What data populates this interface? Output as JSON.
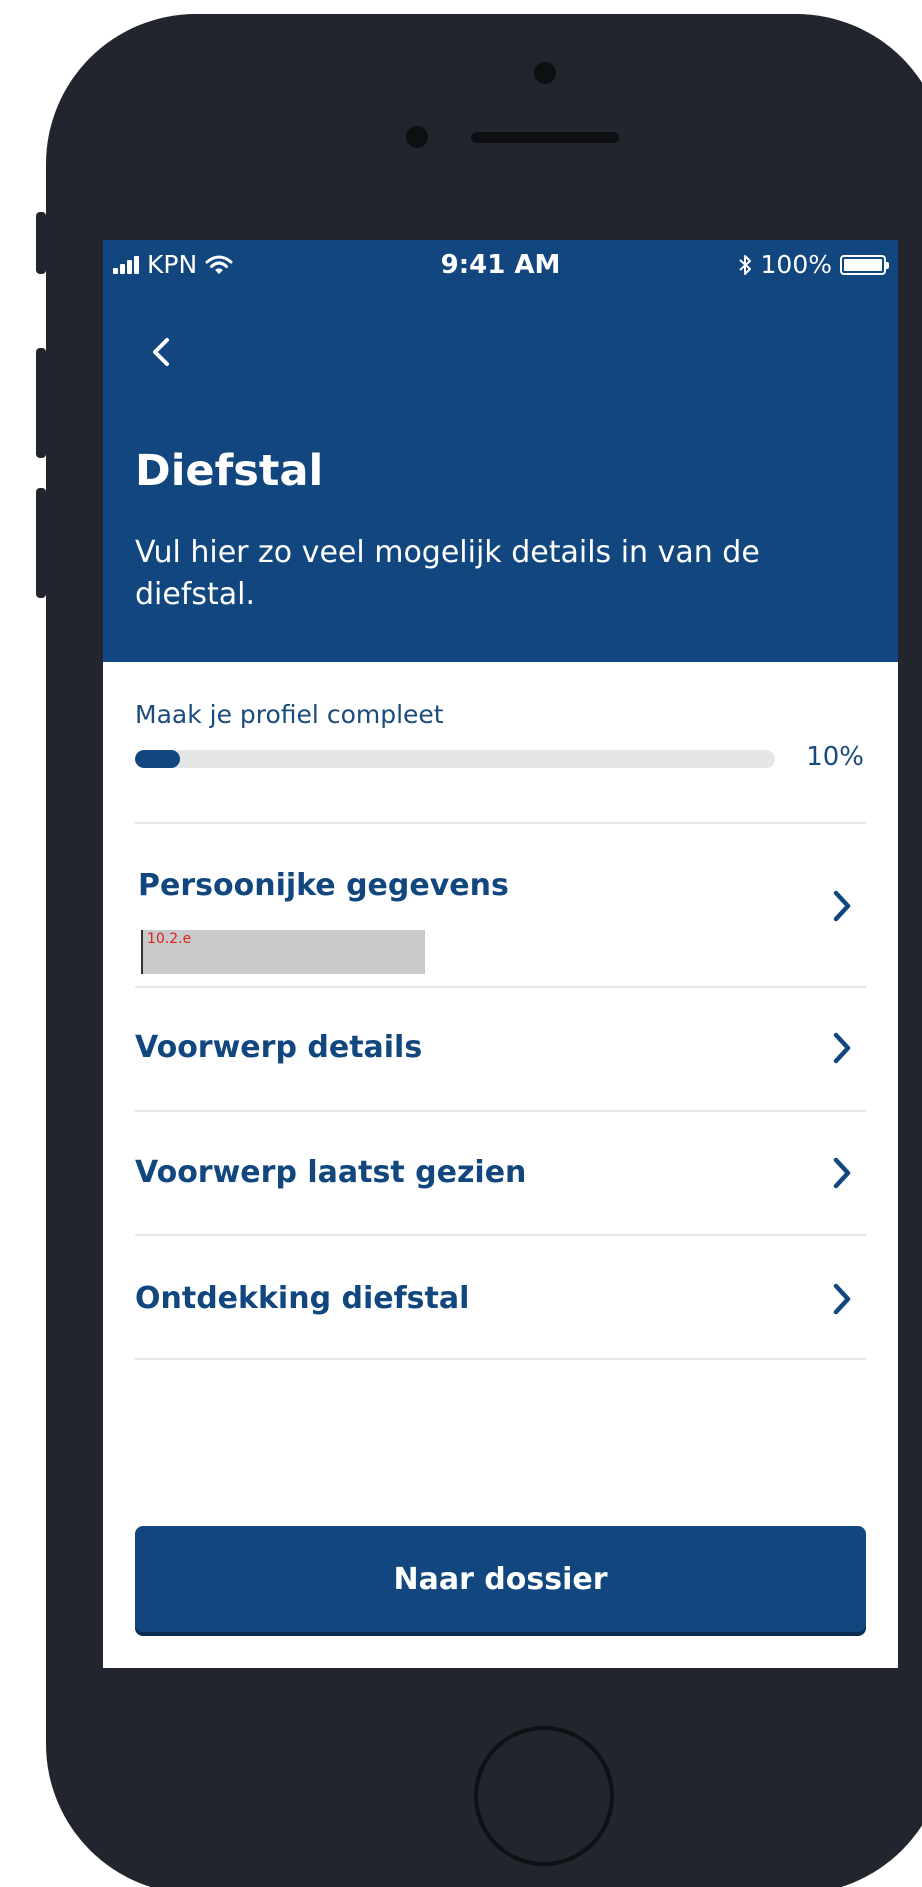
{
  "status_bar": {
    "carrier": "KPN",
    "time": "9:41 AM",
    "battery": "100%"
  },
  "header": {
    "title": "Diefstal",
    "subtitle": "Vul hier zo veel mogelijk details in van de diefstal."
  },
  "progress": {
    "label": "Maak je profiel compleet",
    "percent_text": "10%",
    "value": 0.07
  },
  "sections": [
    {
      "title": "Persoonijke gegevens",
      "redaction_label": "10.2.e"
    },
    {
      "title": "Voorwerp details"
    },
    {
      "title": "Voorwerp laatst gezien"
    },
    {
      "title": "Ontdekking diefstal"
    }
  ],
  "primary_button": {
    "label": "Naar dossier"
  },
  "icons": {
    "back": "chevron-left-icon",
    "row": "chevron-right-icon",
    "signal": "signal-icon",
    "wifi": "wifi-icon",
    "bluetooth": "bluetooth-icon",
    "battery": "battery-icon"
  },
  "colors": {
    "primary": "#11477e",
    "track": "#e5e6e7",
    "divider": "#e4e5e6",
    "redaction": "#c8c9ca",
    "redaction_text": "#e0201a"
  }
}
